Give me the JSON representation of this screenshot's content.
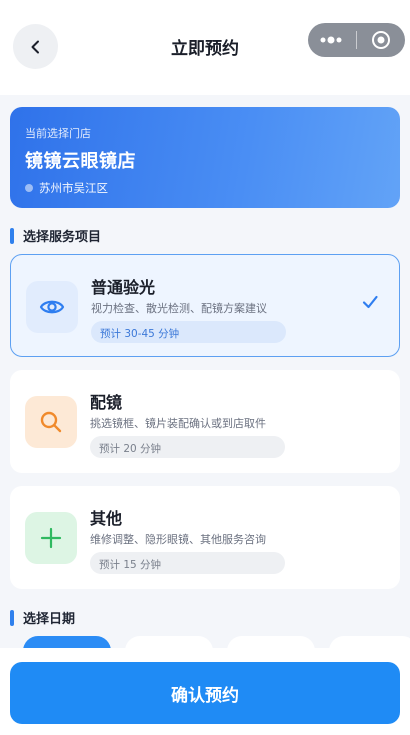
{
  "nav": {
    "title": "立即预约",
    "back_icon": "chevron-left-icon",
    "more_icon": "more-dots-icon",
    "close_icon": "target-close-icon"
  },
  "store": {
    "label": "当前选择门店",
    "name": "镜镜云眼镜店",
    "location": "苏州市吴江区"
  },
  "sections": {
    "service": "选择服务项目",
    "date": "选择日期"
  },
  "services": [
    {
      "name": "普通验光",
      "desc": "视力检查、散光检测、配镜方案建议",
      "tag": "预计 30-45 分钟",
      "icon": "eye-icon",
      "selected": true
    },
    {
      "name": "配镜",
      "desc": "挑选镜框、镜片装配确认或到店取件",
      "tag": "预计 20 分钟",
      "icon": "search-icon",
      "selected": false
    },
    {
      "name": "其他",
      "desc": "维修调整、隐形眼镜、其他服务咨询",
      "tag": "预计 15 分钟",
      "icon": "plus-icon",
      "selected": false
    }
  ],
  "confirm_label": "确认预约",
  "colors": {
    "primary": "#1f8bf5",
    "selected_border": "#5da0f2",
    "eye_icon_bg": "#e1ecfd",
    "search_icon_bg": "#fde9d6",
    "plus_icon_bg": "#ddf5e4"
  }
}
